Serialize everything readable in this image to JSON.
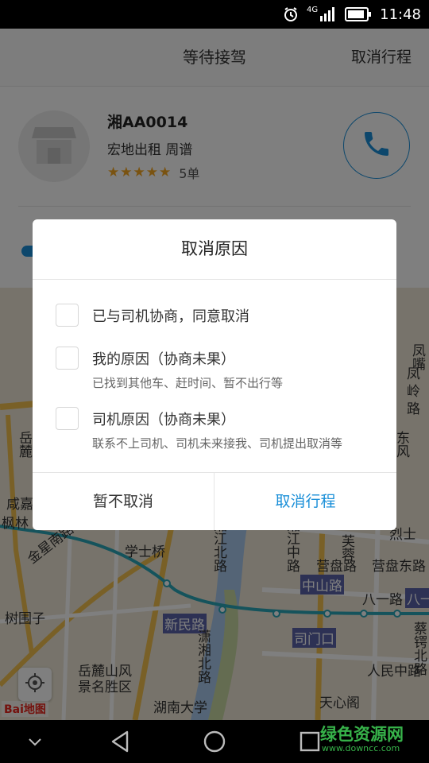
{
  "status_bar": {
    "time": "11:48",
    "network": "4G",
    "icons": [
      "alarm-icon",
      "signal-icon",
      "battery-icon"
    ]
  },
  "header": {
    "title": "等待接驾",
    "cancel_trip": "取消行程"
  },
  "driver": {
    "plate": "湘AA0014",
    "company_name": "宏地出租 周谱",
    "rating_stars": 5,
    "orders": "5单"
  },
  "map": {
    "labels": [
      {
        "text": "学士桥"
      },
      {
        "text": "金星南路"
      },
      {
        "text": "树围子"
      },
      {
        "text": "新民路"
      },
      {
        "text": "中山路"
      },
      {
        "text": "司门口"
      },
      {
        "text": "八一路"
      },
      {
        "text": "营盘东路"
      },
      {
        "text": "营盘路"
      },
      {
        "text": "人民中路"
      },
      {
        "text": "天心阁"
      },
      {
        "text": "岳麓山风"
      },
      {
        "text": "景名胜区"
      },
      {
        "text": "湖南大学"
      },
      {
        "text": "湘江中路"
      },
      {
        "text": "潇湘北路"
      },
      {
        "text": "湘江北路"
      },
      {
        "text": "芙蓉"
      },
      {
        "text": "蔡锷北路"
      },
      {
        "text": "岳麓"
      },
      {
        "text": "凤嘴"
      },
      {
        "text": "东风"
      },
      {
        "text": "凤"
      },
      {
        "text": "岭"
      },
      {
        "text": "路"
      },
      {
        "text": "枫林"
      },
      {
        "text": "咸嘉"
      },
      {
        "text": "烈士"
      },
      {
        "text": "八一"
      }
    ],
    "logo": "Bai地图"
  },
  "dialog": {
    "title": "取消原因",
    "options": [
      {
        "label": "已与司机协商，同意取消",
        "sub": ""
      },
      {
        "label": "我的原因（协商未果）",
        "sub": "已找到其他车、赶时间、暂不出行等"
      },
      {
        "label": "司机原因（协商未果）",
        "sub": "联系不上司机、司机未来接我、司机提出取消等"
      }
    ],
    "keep_button": "暂不取消",
    "confirm_button": "取消行程"
  },
  "nav_bar": {
    "icons": [
      "chevron-down-icon",
      "back-icon",
      "home-icon",
      "recents-icon"
    ]
  },
  "watermark": {
    "title": "绿色资源网",
    "url": "www.downcc.com"
  },
  "colors": {
    "accent": "#1a8fd8",
    "star": "#f5a623",
    "overlay": "rgba(0,0,0,0.5)",
    "watermark": "#37b34a"
  }
}
